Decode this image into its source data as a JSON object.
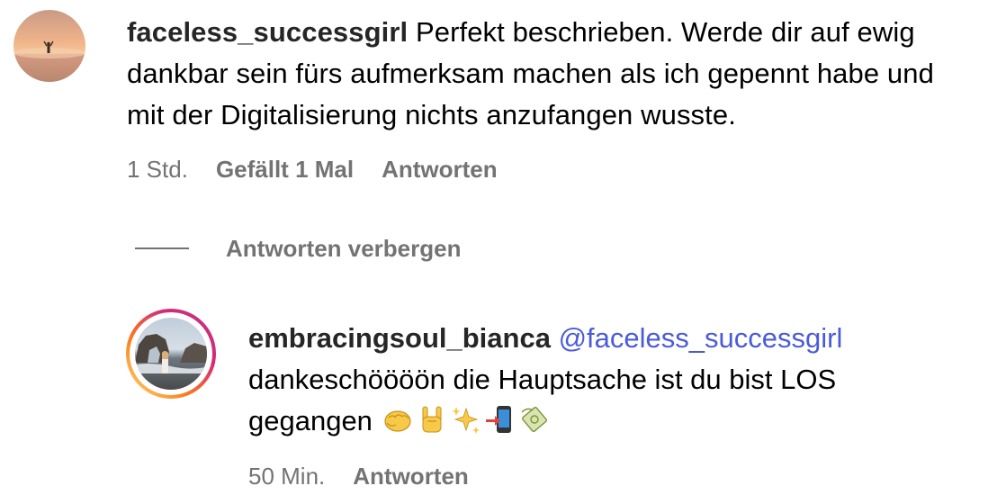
{
  "comment": {
    "username": "faceless_successgirl",
    "text": "Perfekt beschrieben. Werde dir auf ewig dankbar sein fürs aufmerksam machen als ich gepennt habe und mit der Digitalisierung nichts anzufangen wusste.",
    "time": "1 Std.",
    "likes": "Gefällt 1 Mal",
    "reply_label": "Antworten"
  },
  "hide_replies_label": "Antworten verbergen",
  "reply": {
    "username": "embracingsoul_bianca",
    "mention": "@faceless_successgirl",
    "text": "dankeschöööön die Hauptsache ist du bist LOS gegangen",
    "emojis": [
      "oncoming-fist-emoji",
      "sign-of-horns-emoji",
      "sparkles-emoji",
      "mobile-phone-arrow-emoji",
      "money-bag-emoji"
    ],
    "time": "50 Min.",
    "reply_label": "Antworten"
  },
  "colors": {
    "username": "#262626",
    "meta": "#737373",
    "mention": "#4a5bd9",
    "story_ring_start": "#feda75",
    "story_ring_mid": "#fa7e1e",
    "story_ring_end": "#d62976"
  }
}
